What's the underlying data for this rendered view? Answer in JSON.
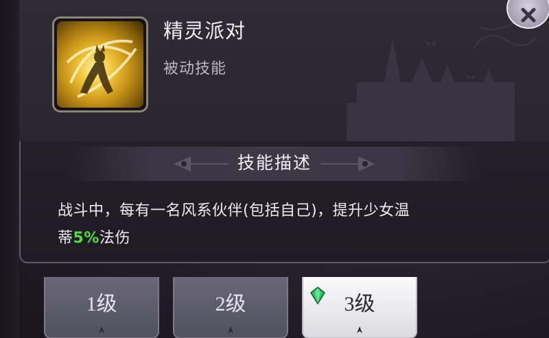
{
  "skill": {
    "name": "精灵派对",
    "type": "被动技能",
    "level_badge": "3",
    "icon": "golden-wind-swirl-icon"
  },
  "section": {
    "title": "技能描述"
  },
  "description": {
    "line1": "战斗中，每有一名风系伙伴(包括自己)，提升少女温",
    "line2_pre": "蒂",
    "line2_highlight": "5%",
    "line2_post": "法伤"
  },
  "level_tabs": [
    {
      "label": "1级",
      "selected": false
    },
    {
      "label": "2级",
      "selected": false
    },
    {
      "label": "3级",
      "selected": true
    }
  ],
  "colors": {
    "highlight": "#4fdc3c",
    "gem": "#2fbf6a",
    "panel": "#2a2631",
    "selected_tab": "#f2f2f4"
  },
  "corner_button_icon": "close-x-icon"
}
